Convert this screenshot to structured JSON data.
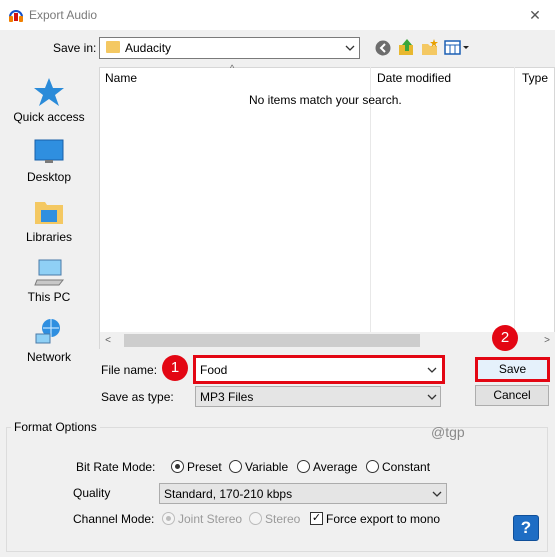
{
  "window": {
    "title": "Export Audio",
    "close_glyph": "✕",
    "icon": "headphones-icon"
  },
  "toolbar": {
    "save_in_label": "Save in:",
    "save_in_value": "Audacity",
    "icons": [
      "back-icon",
      "up-folder-icon",
      "new-folder-icon",
      "view-menu-icon"
    ]
  },
  "places": [
    {
      "label": "Quick access",
      "icon": "star-icon"
    },
    {
      "label": "Desktop",
      "icon": "desktop-icon"
    },
    {
      "label": "Libraries",
      "icon": "libraries-icon"
    },
    {
      "label": "This PC",
      "icon": "computer-icon"
    },
    {
      "label": "Network",
      "icon": "network-icon"
    }
  ],
  "file_list": {
    "columns": [
      "Name",
      "Date modified",
      "Type"
    ],
    "empty_message": "No items match your search."
  },
  "form": {
    "file_name_label": "File name:",
    "file_name_value": "Food",
    "save_as_type_label": "Save as type:",
    "save_as_type_value": "MP3 Files",
    "save_label": "Save",
    "cancel_label": "Cancel",
    "badges": [
      "1",
      "2"
    ]
  },
  "format_options": {
    "title": "Format Options",
    "bit_rate_label": "Bit Rate Mode:",
    "bit_rate_options": [
      "Preset",
      "Variable",
      "Average",
      "Constant"
    ],
    "bit_rate_selected": "Preset",
    "quality_label": "Quality",
    "quality_value": "Standard, 170-210 kbps",
    "channel_label": "Channel Mode:",
    "channel_options": [
      "Joint Stereo",
      "Stereo"
    ],
    "channel_selected": "Joint Stereo",
    "force_mono_label": "Force export to mono",
    "force_mono_checked": true,
    "help_glyph": "?"
  },
  "watermark": "@tgp",
  "colors": {
    "highlight": "#e30613",
    "help_button": "#1e6dc4",
    "folder": "#f4c862"
  }
}
